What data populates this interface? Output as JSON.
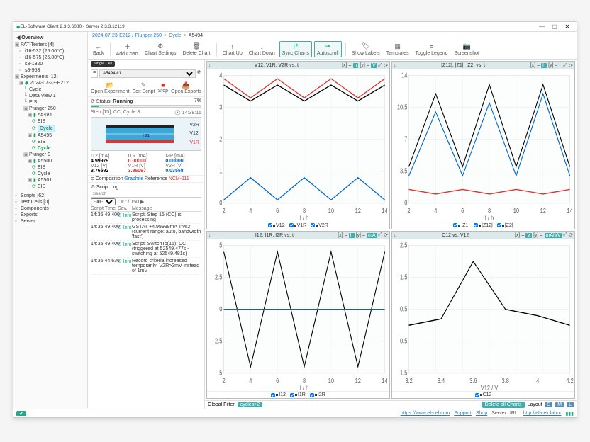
{
  "window": {
    "title": "EL-Software Client 2.3.3.6080 - Server 2.3.3.12119"
  },
  "overview": "Overview",
  "tree": {
    "pat": {
      "label": "PAT-Testers [4]",
      "items": [
        "i16-532 (25.00°C)",
        "i16-575 (25.00°C)",
        "s8-1320",
        "s8-953"
      ]
    },
    "exp": {
      "label": "Experiments [12]",
      "root": "2024-07-23-E212",
      "sub": [
        "Cycle",
        "Data View 1",
        "EIS"
      ],
      "plunger": "Plunger 250",
      "a5494": "A5494",
      "a5495": "A5495",
      "eis": "EIS",
      "cycle": "Cycle",
      "plunger0": "Plunger 0",
      "a5500": "A5500",
      "a5501": "A5501"
    },
    "bottom": [
      "Scripts [62]",
      "Test Cells [0]",
      "Components",
      "Exports",
      "Server"
    ]
  },
  "crumb": {
    "a": "2024-07-23-E212 / Plunger 250",
    "b": "Cycle",
    "c": "A5494"
  },
  "toolbar": {
    "back": "Back",
    "addchart": "Add Chart",
    "chset": "Chart Settings",
    "delchart": "Delete Chart",
    "cup": "Chart Up",
    "cdown": "Chart Down",
    "sync": "Sync Charts",
    "auto": "Autoscroll",
    "labels": "Show Labels",
    "tpl": "Templates",
    "legend": "Toggle Legend",
    "shot": "Screenshot"
  },
  "panel": {
    "tab": "Single Cell",
    "channel": "A5494 #1",
    "open": "Open Experiment",
    "edit": "Edit Script",
    "stop": "Stop",
    "exports": "Open Exports",
    "statuslbl": "Status:",
    "status": "Running",
    "pct": "7%",
    "step": "Step [15],  CC,  Cycle 8",
    "clock": "14:38:16",
    "diag": {
      "v2r": "V2R",
      "v12": "V12",
      "v1r": "V1R",
      "h21": "H21"
    },
    "meas": {
      "h": [
        "I12 [mA]",
        "I1R [mA]",
        "I2R [mA]"
      ],
      "v": [
        "4.99979",
        "0.00000",
        "0.00000"
      ],
      "h2": [
        "V12 [V]",
        "V1R [V]",
        "V2R [V]"
      ],
      "v2": [
        "3.76592",
        "3.86067",
        "0.03558"
      ]
    },
    "comp": {
      "pre": "Composition",
      "g": "Graphite",
      "mid": "Reference",
      "r": "NCM-111"
    },
    "log": {
      "title": "Script Log",
      "search": "Search",
      "filter": "- all -",
      "page": "t / 150",
      "cols": [
        "Script Time",
        "Sev.",
        "Message"
      ],
      "rows": [
        {
          "t": "14:35:49.400",
          "s": "Info",
          "m": "Script: Step 15 (CC) is processing"
        },
        {
          "t": "14:35:49.400",
          "s": "Info",
          "m": "GSTAT +4.99999mA 'I\"vs2' (current range: auto, bandwidth 'fast')"
        },
        {
          "t": "14:35:49.400",
          "s": "Info",
          "m": "Script: SwitchTo(15): CC (triggered at 52549.477s - switching at 52549.481s)"
        },
        {
          "t": "14:35:44.636",
          "s": "Info",
          "m": "Record criteria increased temporarily: V2R>2mV instead of 1mV"
        }
      ]
    }
  },
  "charts": [
    {
      "title": "V12, V1R, V2R vs. t",
      "xu": "h",
      "yu": "V",
      "xlabel": "t / h",
      "legend": [
        {
          "n": "V12",
          "c": "#000"
        },
        {
          "n": "V1R",
          "c": "#d33"
        },
        {
          "n": "V2R",
          "c": "#06c"
        }
      ]
    },
    {
      "title": "|Z12|, |Z1|, |Z2| vs. t",
      "xu": "h",
      "yu": "",
      "xlabel": "t / h",
      "legend": [
        {
          "n": "|Z1|",
          "c": "#d33"
        },
        {
          "n": "|Z12|",
          "c": "#000"
        },
        {
          "n": "|Z2|",
          "c": "#06c"
        }
      ]
    },
    {
      "title": "I12, I1R, I2R vs. t",
      "xu": "h",
      "yu": "mA",
      "xlabel": "t / h",
      "legend": [
        {
          "n": "I12",
          "c": "#000"
        },
        {
          "n": "I1R",
          "c": "#d33"
        },
        {
          "n": "I2R",
          "c": "#06c"
        }
      ]
    },
    {
      "title": "C12 vs. V12",
      "xu": "V",
      "yu": "mAh/V",
      "xlabel": "V12 / V",
      "legend": [
        {
          "n": "C12",
          "c": "#000"
        }
      ]
    }
  ],
  "chart_data": [
    {
      "type": "line",
      "xlabel": "t / h",
      "ylabel": "V",
      "x": [
        2,
        4,
        6,
        8,
        10,
        12,
        14
      ],
      "series": [
        {
          "name": "V1R",
          "color": "#d33",
          "y": [
            3.9,
            3.3,
            3.9,
            3.3,
            3.9,
            3.3,
            3.9
          ]
        },
        {
          "name": "V12",
          "color": "#000",
          "y": [
            3.7,
            3.2,
            3.7,
            3.2,
            3.7,
            3.2,
            3.7
          ]
        },
        {
          "name": "V2R",
          "color": "#06c",
          "y": [
            0.1,
            0.8,
            0.1,
            0.8,
            0.1,
            0.8,
            0.1
          ]
        }
      ],
      "ylim": [
        0,
        4
      ]
    },
    {
      "type": "line",
      "xlabel": "t / h",
      "ylabel": "",
      "x": [
        2,
        4,
        6,
        8,
        10,
        12,
        14
      ],
      "series": [
        {
          "name": "|Z12|",
          "color": "#000",
          "y": [
            4,
            12,
            4,
            13,
            4,
            13,
            4
          ]
        },
        {
          "name": "|Z2|",
          "color": "#06c",
          "y": [
            3,
            10,
            3,
            11,
            3,
            12,
            3
          ]
        },
        {
          "name": "|Z1|",
          "color": "#d33",
          "y": [
            1.5,
            1,
            1.5,
            1,
            1.5,
            1,
            1.5
          ]
        }
      ],
      "ylim": [
        0,
        14
      ]
    },
    {
      "type": "line",
      "xlabel": "t / h",
      "ylabel": "mA",
      "x": [
        2,
        4,
        6,
        8,
        10,
        12,
        14
      ],
      "series": [
        {
          "name": "I12",
          "color": "#000",
          "y": [
            4.5,
            -4.5,
            4.5,
            -4.5,
            4.5,
            -4.5,
            4.5
          ]
        },
        {
          "name": "I1R",
          "color": "#d33",
          "y": [
            0,
            0,
            0,
            0,
            0,
            0,
            0
          ]
        },
        {
          "name": "I2R",
          "color": "#06c",
          "y": [
            0,
            0,
            0,
            0,
            0,
            0,
            0
          ]
        }
      ],
      "ylim": [
        -5,
        5
      ]
    },
    {
      "type": "line",
      "xlabel": "V12 / V",
      "ylabel": "mAh/V",
      "x": [
        3.2,
        3.4,
        3.6,
        3.8,
        4.0,
        4.2
      ],
      "series": [
        {
          "name": "C12",
          "color": "#000",
          "y": [
            0,
            0.2,
            2,
            0.5,
            0.3,
            0
          ]
        }
      ],
      "ylim": [
        -1.5,
        2.5
      ]
    }
  ],
  "chartbar": {
    "gf": "Global Filter",
    "badge": "cycles>2",
    "del": "Delete all Charts",
    "layout": "Layout",
    "a": "S",
    "b": "M",
    "c": "L"
  },
  "status": {
    "www": "https://www.el-cel.com",
    "sup": "Support",
    "shop": "Shop",
    "srv": "Server URL:",
    "url": "http://el-cek.labor"
  }
}
